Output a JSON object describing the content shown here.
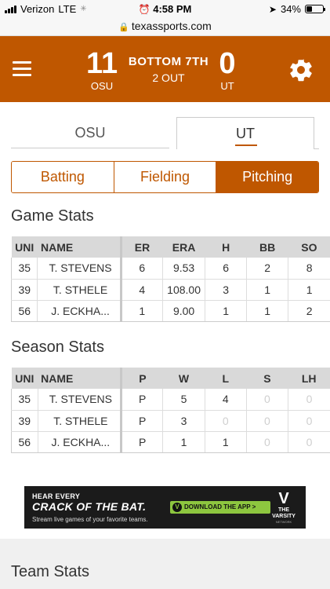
{
  "status_bar": {
    "carrier": "Verizon",
    "network": "LTE",
    "time": "4:58 PM",
    "battery": "34%",
    "battery_level": 0.34
  },
  "browser": {
    "url": "texassports.com"
  },
  "header": {
    "away_score": "11",
    "away_team": "OSU",
    "inning": "BOTTOM 7TH",
    "outs": "2 OUT",
    "home_score": "0",
    "home_team": "UT",
    "accent_color": "#bf5700"
  },
  "team_tabs": [
    {
      "label": "OSU"
    },
    {
      "label": "UT"
    }
  ],
  "stat_tabs": [
    {
      "label": "Batting"
    },
    {
      "label": "Fielding"
    },
    {
      "label": "Pitching"
    }
  ],
  "game_stats": {
    "title": "Game Stats",
    "columns": [
      "UNI",
      "NAME",
      "ER",
      "ERA",
      "H",
      "BB",
      "SO"
    ],
    "rows": [
      [
        "35",
        "T. STEVENS",
        "6",
        "9.53",
        "6",
        "2",
        "8"
      ],
      [
        "39",
        "T. STHELE",
        "4",
        "108.00",
        "3",
        "1",
        "1"
      ],
      [
        "56",
        "J. ECKHA...",
        "1",
        "9.00",
        "1",
        "1",
        "2"
      ]
    ]
  },
  "season_stats": {
    "title": "Season Stats",
    "columns": [
      "UNI",
      "NAME",
      "P",
      "W",
      "L",
      "S",
      "LH"
    ],
    "rows": [
      [
        "35",
        "T. STEVENS",
        "P",
        "5",
        "4",
        "0",
        "0"
      ],
      [
        "39",
        "T. STHELE",
        "P",
        "3",
        "0",
        "0",
        "0"
      ],
      [
        "56",
        "J. ECKHA...",
        "P",
        "1",
        "1",
        "0",
        "0"
      ]
    ]
  },
  "ad": {
    "line1": "HEAR EVERY",
    "line2": "CRACK OF THE BAT.",
    "line3": "Stream live games of your favorite teams.",
    "button": "DOWNLOAD THE APP >",
    "brand": "THE VARSITY",
    "network": "NETWORK"
  },
  "team_stats": {
    "title": "Team Stats"
  }
}
